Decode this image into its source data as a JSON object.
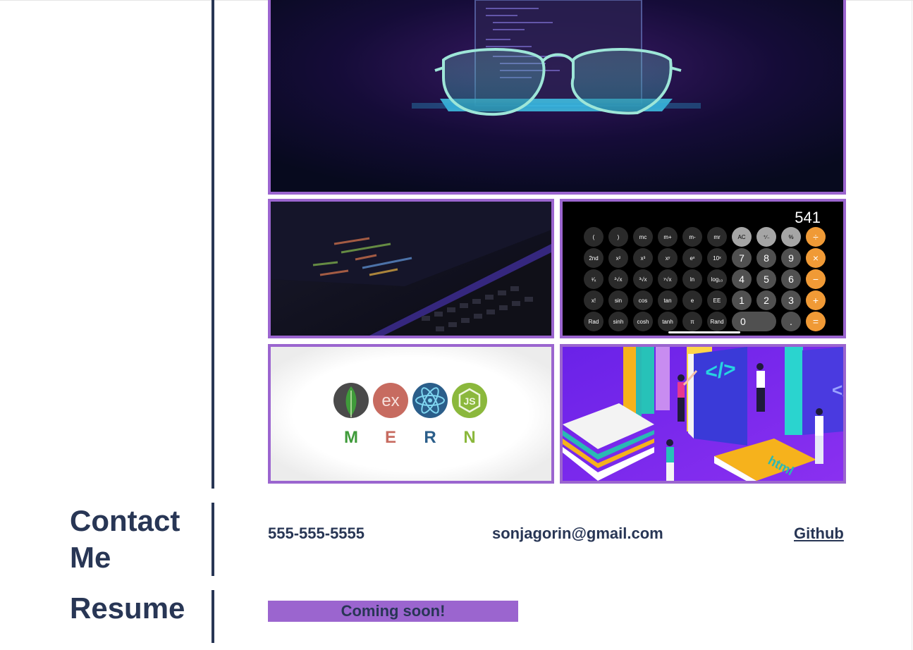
{
  "portfolio": {
    "tiles": [
      {
        "alt": "glasses-laptop-project"
      },
      {
        "alt": "code-laptop-project"
      },
      {
        "alt": "calculator-project"
      },
      {
        "alt": "mern-project"
      },
      {
        "alt": "coding-books-project"
      }
    ],
    "calculator": {
      "display": "541",
      "rows": [
        [
          "(",
          ")",
          "mc",
          "m+",
          "m-",
          "mr",
          "AC",
          "⁺∕₋",
          "%",
          "÷"
        ],
        [
          "2nd",
          "x²",
          "x³",
          "xʸ",
          "eˣ",
          "10ˣ",
          "7",
          "8",
          "9",
          "×"
        ],
        [
          "¹⁄ₓ",
          "²√x",
          "³√x",
          "ʸ√x",
          "ln",
          "log₁₀",
          "4",
          "5",
          "6",
          "−"
        ],
        [
          "x!",
          "sin",
          "cos",
          "tan",
          "e",
          "EE",
          "1",
          "2",
          "3",
          "+"
        ],
        [
          "Rad",
          "sinh",
          "cosh",
          "tanh",
          "π",
          "Rand",
          "0",
          ".",
          "="
        ]
      ]
    },
    "mern": {
      "letters": [
        "M",
        "E",
        "R",
        "N"
      ],
      "icons": [
        "mongodb-leaf",
        "express-ex",
        "react-atom",
        "node-js"
      ]
    },
    "books": {
      "code_tag": "</>",
      "book_label": "html"
    }
  },
  "contact": {
    "title": "Contact Me",
    "phone": "555-555-5555",
    "email": "sonjagorin@gmail.com",
    "github": "Github"
  },
  "resume": {
    "title": "Resume",
    "status": "Coming soon!"
  },
  "colors": {
    "accent": "#9b65cf",
    "text": "#283655"
  }
}
